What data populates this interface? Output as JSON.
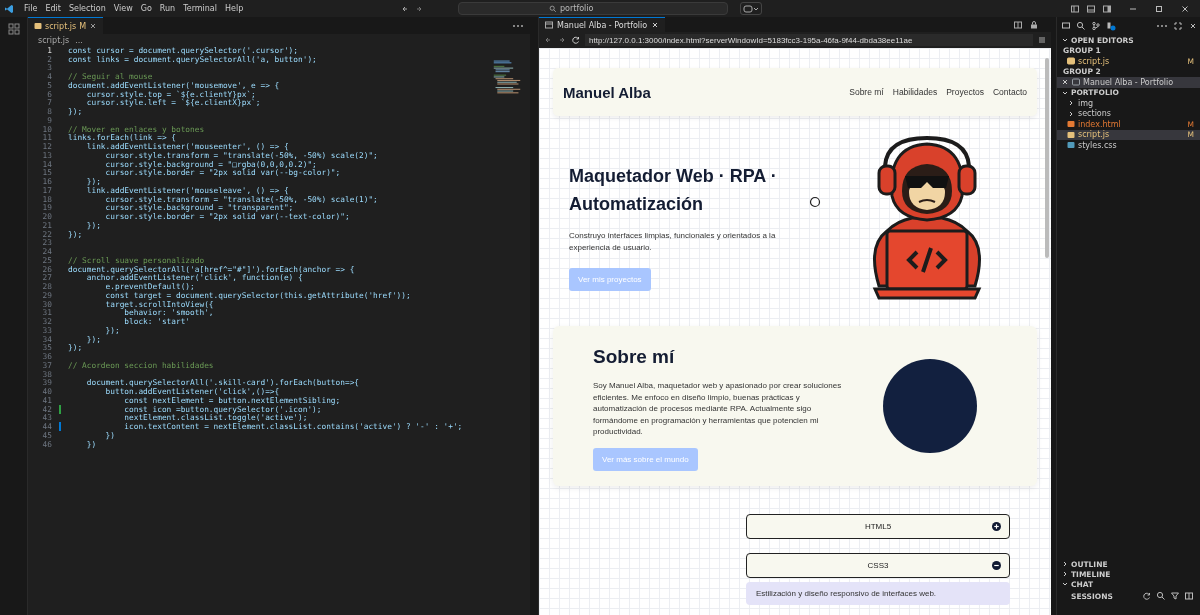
{
  "menu": [
    "File",
    "Edit",
    "Selection",
    "View",
    "Go",
    "Run",
    "Terminal",
    "Help"
  ],
  "command_center": {
    "text": "portfolio"
  },
  "editor": {
    "tab": {
      "filename": "script.js",
      "badge": "M"
    },
    "breadcrumb": [
      "script.js",
      "..."
    ],
    "lines": [
      {
        "number": "1",
        "kind": "code",
        "text": "const cursor = document.querySelector('.cursor');"
      },
      {
        "number": "2",
        "kind": "code",
        "text": "const links = document.querySelectorAll('a, button');"
      },
      {
        "number": "3",
        "kind": "blank"
      },
      {
        "number": "4",
        "kind": "comment",
        "text": "// Seguir al mouse"
      },
      {
        "number": "5",
        "kind": "code",
        "text": "document.addEventListener('mousemove', e => {"
      },
      {
        "number": "6",
        "kind": "code",
        "text": "    cursor.style.top = `${e.clientY}px`;"
      },
      {
        "number": "7",
        "kind": "code",
        "text": "    cursor.style.left = `${e.clientX}px`;"
      },
      {
        "number": "8",
        "kind": "code",
        "text": "});"
      },
      {
        "number": "9",
        "kind": "blank"
      },
      {
        "number": "10",
        "kind": "comment",
        "text": "// Mover en enlaces y botones"
      },
      {
        "number": "11",
        "kind": "code",
        "text": "links.forEach(link => {"
      },
      {
        "number": "12",
        "kind": "code",
        "text": "    link.addEventListener('mouseenter', () => {"
      },
      {
        "number": "13",
        "kind": "code",
        "text": "        cursor.style.transform = \"translate(-50%, -50%) scale(2)\";"
      },
      {
        "number": "14",
        "kind": "code",
        "text": "        cursor.style.background = \"□rgba(0,0,0,0.2)\";"
      },
      {
        "number": "15",
        "kind": "code",
        "text": "        cursor.style.border = \"2px solid var(--bg-color)\";"
      },
      {
        "number": "16",
        "kind": "code",
        "text": "    });"
      },
      {
        "number": "17",
        "kind": "code",
        "text": "    link.addEventListener('mouseleave', () => {"
      },
      {
        "number": "18",
        "kind": "code",
        "text": "        cursor.style.transform = \"translate(-50%, -50%) scale(1)\";"
      },
      {
        "number": "19",
        "kind": "code",
        "text": "        cursor.style.background = \"transparent\";"
      },
      {
        "number": "20",
        "kind": "code",
        "text": "        cursor.style.border = \"2px solid var(--text-color)\";"
      },
      {
        "number": "21",
        "kind": "code",
        "text": "    });"
      },
      {
        "number": "22",
        "kind": "code",
        "text": "});"
      },
      {
        "number": "23",
        "kind": "blank"
      },
      {
        "number": "24",
        "kind": "blank"
      },
      {
        "number": "25",
        "kind": "comment",
        "text": "// Scroll suave personalizado"
      },
      {
        "number": "26",
        "kind": "code",
        "text": "document.querySelectorAll('a[href^=\"#\"]').forEach(anchor => {"
      },
      {
        "number": "27",
        "kind": "code",
        "text": "    anchor.addEventListener('click', function(e) {"
      },
      {
        "number": "28",
        "kind": "code",
        "text": "        e.preventDefault();"
      },
      {
        "number": "29",
        "kind": "code",
        "text": "        const target = document.querySelector(this.getAttribute('href'));"
      },
      {
        "number": "30",
        "kind": "code",
        "text": "        target.scrollIntoView({"
      },
      {
        "number": "31",
        "kind": "code",
        "text": "            behavior: 'smooth',"
      },
      {
        "number": "32",
        "kind": "code",
        "text": "            block: 'start'"
      },
      {
        "number": "33",
        "kind": "code",
        "text": "        });"
      },
      {
        "number": "34",
        "kind": "code",
        "text": "    });"
      },
      {
        "number": "35",
        "kind": "code",
        "text": "});"
      },
      {
        "number": "36",
        "kind": "blank"
      },
      {
        "number": "37",
        "kind": "comment",
        "text": "// Acordeon seccion habilidades"
      },
      {
        "number": "38",
        "kind": "blank"
      },
      {
        "number": "39",
        "kind": "code",
        "text": "    document.querySelectorAll('.skill-card').forEach(button=>{"
      },
      {
        "number": "40",
        "kind": "code",
        "text": "        button.addEventListener('click',()=>{"
      },
      {
        "number": "41",
        "kind": "code",
        "text": "            const nextElement = button.nextElementSibling;"
      },
      {
        "number": "42",
        "kind": "code",
        "color": "#2ea043",
        "text": "            const icon =button.querySelector('.icon');"
      },
      {
        "number": "43",
        "kind": "code",
        "text": "            nextElement.classList.toggle('active');"
      },
      {
        "number": "44",
        "kind": "code",
        "color": "#0078d4",
        "text": "            icon.textContent = nextElement.classList.contains('active') ? '-' : '+';"
      },
      {
        "number": "45",
        "kind": "code",
        "text": "        })"
      },
      {
        "number": "46",
        "kind": "code",
        "text": "    })"
      }
    ]
  },
  "browser": {
    "tab_title": "Manuel Alba - Portfolio",
    "url": "http://127.0.0.1:3000/index.html?serverWindowId=5183fcc3-195a-46fa-9f44-dbda38ee11ae",
    "page": {
      "nav": {
        "brand": "Manuel Alba",
        "links": [
          "Sobre mí",
          "Habilidades",
          "Proyectos",
          "Contacto"
        ]
      },
      "hero": {
        "title": "Maquetador Web · RPA · Automatización",
        "text": "Construyo interfaces limpias, funcionales y orientados a la experiencia de usuario.",
        "button": "Ver mis proyectos"
      },
      "about": {
        "title": "Sobre mí",
        "text": "Soy Manuel Alba, maquetador web y apasionado por crear soluciones eficientes. Me enfoco en diseño limpio, buenas prácticas y automatización de procesos mediante RPA. Actualmente sigo formándome en programación y herramientas que potencien mi productividad.",
        "button": "Ver más sobre el mundo"
      },
      "skills": [
        {
          "name": "HTML5",
          "expanded": false
        },
        {
          "name": "CSS3",
          "expanded": true,
          "description": "Estilización y diseño responsivo de interfaces web."
        }
      ]
    }
  },
  "sidebar": {
    "open_editors": {
      "title": "OPEN EDITORS",
      "groups": [
        {
          "title": "GROUP 1",
          "items": [
            {
              "label": "script.js",
              "kind": "js",
              "badge": "M"
            }
          ]
        },
        {
          "title": "GROUP 2",
          "items": [
            {
              "label": "Manuel Alba - Portfolio",
              "kind": "preview"
            }
          ]
        }
      ]
    },
    "folder": {
      "title": "PORTFOLIO",
      "items": [
        {
          "label": "img",
          "kind": "folder",
          "expanded": false,
          "selected": false
        },
        {
          "label": "sections",
          "kind": "folder",
          "expanded": false,
          "selected": false
        },
        {
          "label": "index.html",
          "kind": "html",
          "badge": "M",
          "selected": false
        },
        {
          "label": "script.js",
          "kind": "js",
          "badge": "M",
          "selected": true
        },
        {
          "label": "styles.css",
          "kind": "css",
          "selected": false
        }
      ]
    },
    "panels": [
      {
        "title": "OUTLINE",
        "expanded": false
      },
      {
        "title": "TIMELINE",
        "expanded": false
      },
      {
        "title": "CHAT",
        "expanded": true
      }
    ],
    "sessions": "SESSIONS"
  }
}
